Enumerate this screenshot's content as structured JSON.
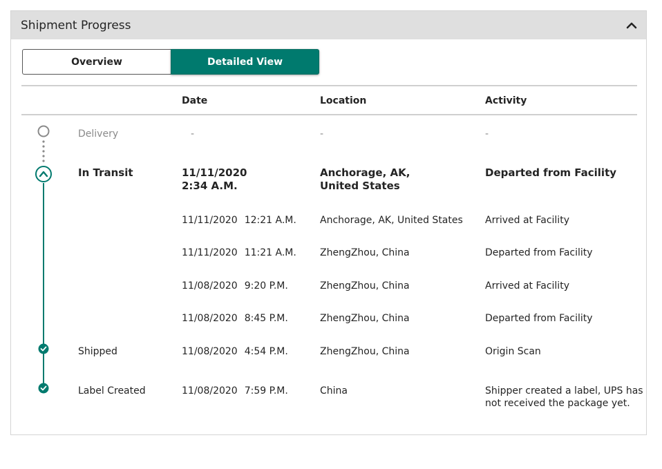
{
  "panel": {
    "title": "Shipment Progress",
    "collapse_icon": "chevron-up-icon"
  },
  "toggle": {
    "overview_label": "Overview",
    "detailed_label": "Detailed View",
    "active": "Detailed View"
  },
  "columns": {
    "date": "Date",
    "location": "Location",
    "activity": "Activity"
  },
  "colors": {
    "accent": "#007a6e",
    "muted": "#8a8a8a"
  },
  "delivery": {
    "status": "Delivery",
    "date": "-",
    "location": "-",
    "activity": "-"
  },
  "in_transit": {
    "status": "In Transit",
    "date_line1": "11/11/2020",
    "date_line2": "2:34 A.M.",
    "location": "Anchorage, AK, United States",
    "activity": "Departed from Facility",
    "events": [
      {
        "date": "11/11/2020",
        "time": "12:21 A.M.",
        "location": "Anchorage, AK, United States",
        "activity": "Arrived at Facility"
      },
      {
        "date": "11/11/2020",
        "time": "11:21 A.M.",
        "location": "ZhengZhou, China",
        "activity": "Departed from Facility"
      },
      {
        "date": "11/08/2020",
        "time": "9:20 P.M.",
        "location": "ZhengZhou, China",
        "activity": "Arrived at Facility"
      },
      {
        "date": "11/08/2020",
        "time": "8:45 P.M.",
        "location": "ZhengZhou, China",
        "activity": "Departed from Facility"
      }
    ]
  },
  "shipped": {
    "status": "Shipped",
    "date": "11/08/2020",
    "time": "4:54 P.M.",
    "location": "ZhengZhou, China",
    "activity": "Origin Scan"
  },
  "label_created": {
    "status": "Label Created",
    "date": "11/08/2020",
    "time": "7:59 P.M.",
    "location": "China",
    "activity_line1": "Shipper created a label, UPS has",
    "activity_line2": "not received the package yet."
  }
}
